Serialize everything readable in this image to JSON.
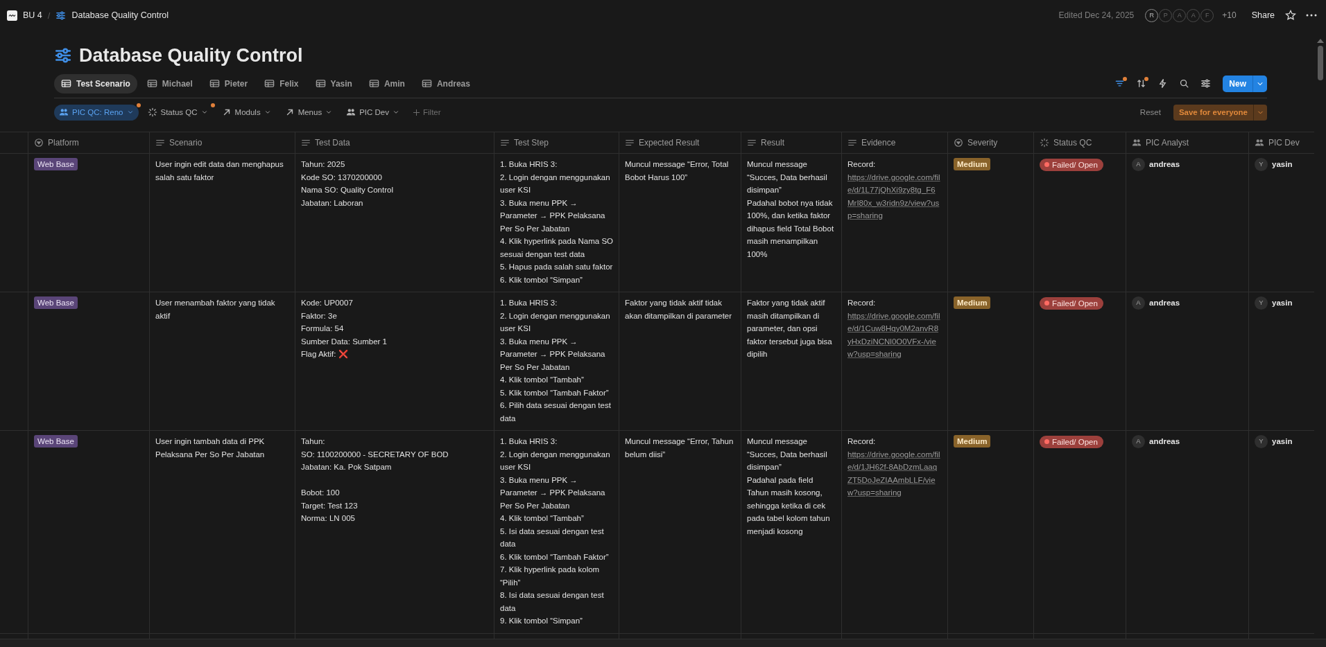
{
  "breadcrumb": [
    {
      "label": "BU 4",
      "kind": "workspace"
    },
    {
      "label": "Database Quality Control",
      "kind": "page"
    }
  ],
  "breadcrumb_separator": "/",
  "topbar": {
    "edited": "Edited Dec 24, 2025",
    "avatars": [
      "R",
      "P",
      "A",
      "A",
      "F"
    ],
    "more_count": "+10",
    "share": "Share"
  },
  "title": "Database Quality Control",
  "tabs": [
    {
      "label": "Test Scenario",
      "selected": true
    },
    {
      "label": "Michael",
      "selected": false
    },
    {
      "label": "Pieter",
      "selected": false
    },
    {
      "label": "Felix",
      "selected": false
    },
    {
      "label": "Yasin",
      "selected": false
    },
    {
      "label": "Amin",
      "selected": false
    },
    {
      "label": "Andreas",
      "selected": false
    }
  ],
  "actions": [
    {
      "kind": "filter",
      "active": true,
      "indicator": true
    },
    {
      "kind": "sort",
      "active": false,
      "indicator": true
    },
    {
      "kind": "automation",
      "active": false,
      "indicator": false
    },
    {
      "kind": "search",
      "active": false,
      "indicator": false
    },
    {
      "kind": "settings",
      "active": false,
      "indicator": false
    }
  ],
  "new_button": "New",
  "filters": [
    {
      "label": "PIC QC: Reno",
      "kind": "person",
      "active": true,
      "indicator": true
    },
    {
      "label": "Status QC",
      "kind": "status",
      "active": false,
      "indicator": true
    },
    {
      "label": "Moduls",
      "kind": "relation",
      "active": false,
      "indicator": false
    },
    {
      "label": "Menus",
      "kind": "relation",
      "active": false,
      "indicator": false
    },
    {
      "label": "PIC Dev",
      "kind": "person",
      "active": false,
      "indicator": false
    }
  ],
  "add_filter": "Filter",
  "reset": "Reset",
  "save": "Save for everyone",
  "columns": [
    {
      "label": "Platform",
      "kind": "select"
    },
    {
      "label": "Scenario",
      "kind": "text"
    },
    {
      "label": "Test Data",
      "kind": "text"
    },
    {
      "label": "Test Step",
      "kind": "text"
    },
    {
      "label": "Expected Result",
      "kind": "text"
    },
    {
      "label": "Result",
      "kind": "text"
    },
    {
      "label": "Evidence",
      "kind": "text"
    },
    {
      "label": "Severity",
      "kind": "select"
    },
    {
      "label": "Status QC",
      "kind": "status"
    },
    {
      "label": "PIC Analyst",
      "kind": "person"
    },
    {
      "label": "PIC Dev",
      "kind": "person"
    }
  ],
  "rows": [
    {
      "platform": "Web Base",
      "scenario": "User ingin edit data dan menghapus salah satu faktor",
      "test_data": [
        [
          "Tahun: 2025",
          "Kode SO: 1370200000",
          "Nama SO: Quality Control",
          "Jabatan: Laboran"
        ]
      ],
      "test_step": [
        "1. Buka HRIS 3:",
        "2. Login dengan menggunakan user KSI",
        "3. Buka menu PPK → Parameter → PPK Pelaksana Per So Per Jabatan",
        "4. Klik hyperlink pada Nama SO sesuai dengan test data",
        "5. Hapus pada salah satu faktor",
        "6. Klik tombol “Simpan”"
      ],
      "expected": "Muncul message “Error, Total Bobot Harus 100”",
      "result": [
        "Muncul message “Succes, Data berhasil disimpan”",
        "Padahal bobot nya tidak 100%, dan ketika faktor dihapus field Total Bobot masih menampilkan 100%"
      ],
      "evidence": {
        "label": "Record:",
        "url": "https://drive.google.com/file/d/1L77jQhXi9zy8tg_F6MrI80x_w3ridn9z/view?usp=sharing"
      },
      "severity": "Medium",
      "status": "Failed/ Open",
      "pic_analyst": {
        "initial": "A",
        "name": "andreas"
      },
      "pic_dev": {
        "initial": "Y",
        "name": "yasin"
      }
    },
    {
      "platform": "Web Base",
      "scenario": "User menambah faktor yang tidak aktif",
      "test_data": [
        [
          "Kode: UP0007",
          "Faktor: 3e",
          "Formula: 54",
          "Sumber Data: Sumber 1",
          "Flag Aktif: ❌"
        ]
      ],
      "test_step": [
        "1. Buka HRIS 3:",
        "2. Login dengan menggunakan user KSI",
        "3. Buka menu PPK → Parameter → PPK Pelaksana Per So Per Jabatan",
        "4. Klik tombol “Tambah”",
        "5. Klik tombol “Tambah Faktor”",
        "6. Pilih data sesuai dengan test data"
      ],
      "expected": "Faktor yang tidak aktif tidak akan ditampilkan di parameter",
      "result": [
        "Faktor yang tidak aktif masih ditampilkan di parameter, dan opsi faktor tersebut juga bisa dipilih"
      ],
      "evidence": {
        "label": "Record:",
        "url": "https://drive.google.com/file/d/1Cuw8Hqy0M2anvR8yHxDziNCNl0O0VFx-/view?usp=sharing"
      },
      "severity": "Medium",
      "status": "Failed/ Open",
      "pic_analyst": {
        "initial": "A",
        "name": "andreas"
      },
      "pic_dev": {
        "initial": "Y",
        "name": "yasin"
      }
    },
    {
      "platform": "Web Base",
      "scenario": "User ingin tambah data di PPK Pelaksana Per So Per Jabatan",
      "test_data": [
        [
          "Tahun:",
          "SO: 1100200000 - SECRETARY OF BOD",
          "Jabatan: Ka. Pok Satpam"
        ],
        [
          "Bobot: 100",
          "Target: Test 123",
          "Norma: LN 005"
        ]
      ],
      "test_step": [
        "1. Buka HRIS 3:",
        "2. Login dengan menggunakan user KSI",
        "3. Buka menu PPK → Parameter → PPK Pelaksana Per So Per Jabatan",
        "4. Klik tombol “Tambah”",
        "5. Isi data sesuai dengan test data",
        "6. Klik tombol “Tambah Faktor”",
        "7. Klik hyperlink pada kolom “Pilih”",
        "8. Isi data sesuai dengan test data",
        "9. Klik tombol “Simpan”"
      ],
      "expected": "Muncul message “Error, Tahun belum diisi”",
      "result": [
        "Muncul message “Succes, Data berhasil disimpan”",
        "Padahal pada field Tahun masih kosong, sehingga ketika di cek pada tabel kolom tahun menjadi kosong"
      ],
      "evidence": {
        "label": "Record:",
        "url": "https://drive.google.com/file/d/1JH62f-8AbDzmLaaqZT5DoJeZIAAmbLLF/view?usp=sharing"
      },
      "severity": "Medium",
      "status": "Failed/ Open",
      "pic_analyst": {
        "initial": "A",
        "name": "andreas"
      },
      "pic_dev": {
        "initial": "Y",
        "name": "yasin"
      }
    }
  ]
}
